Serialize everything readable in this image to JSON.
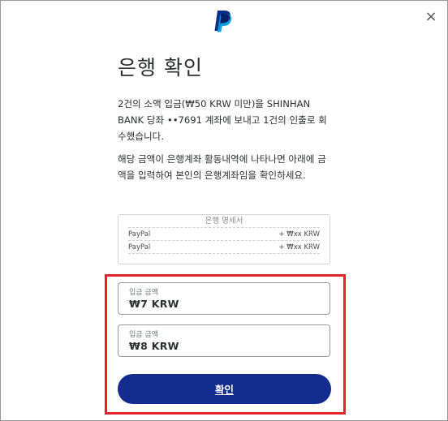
{
  "dialog": {
    "logo_icon": "paypal-logo",
    "close_icon": "×"
  },
  "title": "은행 확인",
  "paragraphs": [
    "2건의 소액 입금(₩50 KRW 미만)을 SHINHAN BANK 당좌 ••7691 계좌에 보내고 1건의 인출로 회수했습니다.",
    "해당 금액이 은행계좌 활동내역에 나타나면 아래에 금액을 입력하여 본인의 은행계좌임을 확인하세요."
  ],
  "statement": {
    "header": "은행 명세서",
    "rows": [
      {
        "name": "PayPal",
        "amount": "+ ₩xx KRW"
      },
      {
        "name": "PayPal",
        "amount": "+ ₩xx KRW"
      }
    ]
  },
  "deposit_fields": [
    {
      "label": "입금 금액",
      "value": "₩7 KRW"
    },
    {
      "label": "입금 금액",
      "value": "₩8 KRW"
    }
  ],
  "confirm_button": "확인",
  "colors": {
    "brand_dark": "#003087",
    "brand_light": "#009cde",
    "button": "#142c8e",
    "highlight": "#e4232a"
  }
}
